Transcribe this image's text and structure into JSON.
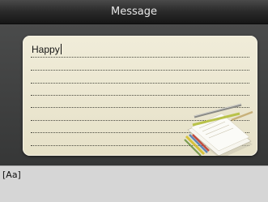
{
  "window": {
    "title": "Message"
  },
  "message": {
    "text": "Happy"
  },
  "input_method": {
    "mode_label": "[Aa]"
  },
  "icons": {
    "decoration": "notepad-pencil-icon"
  },
  "colors": {
    "title_bar": "#1e1e1e",
    "background": "#3f4040",
    "note_paper": "#ebe6cf",
    "ruled_lines": "#4a4a40",
    "input_bar": "#d6d6d6"
  }
}
